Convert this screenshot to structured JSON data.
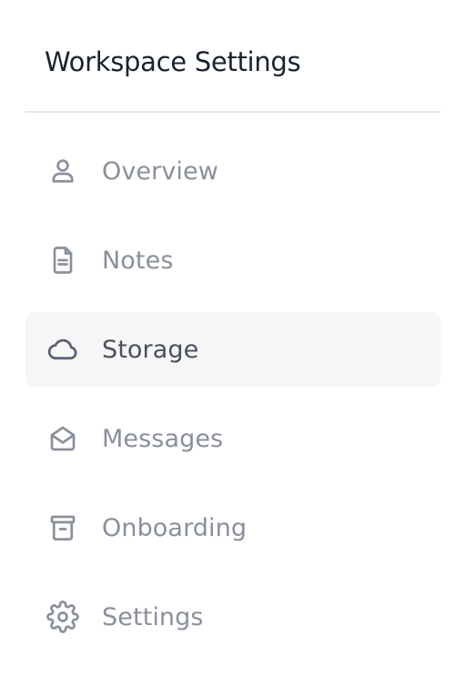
{
  "header": {
    "title": "Workspace Settings"
  },
  "nav": {
    "items": [
      {
        "label": "Overview",
        "icon": "user-icon",
        "active": false
      },
      {
        "label": "Notes",
        "icon": "document-icon",
        "active": false
      },
      {
        "label": "Storage",
        "icon": "cloud-icon",
        "active": true
      },
      {
        "label": "Messages",
        "icon": "mail-open-icon",
        "active": false
      },
      {
        "label": "Onboarding",
        "icon": "archive-icon",
        "active": false
      },
      {
        "label": "Settings",
        "icon": "gear-icon",
        "active": false
      }
    ]
  },
  "colors": {
    "title": "#1b2230",
    "inactive": "#8a909b",
    "active_text": "#4a505c",
    "active_background": "#f6f6f7",
    "divider": "#e4e6ea"
  }
}
